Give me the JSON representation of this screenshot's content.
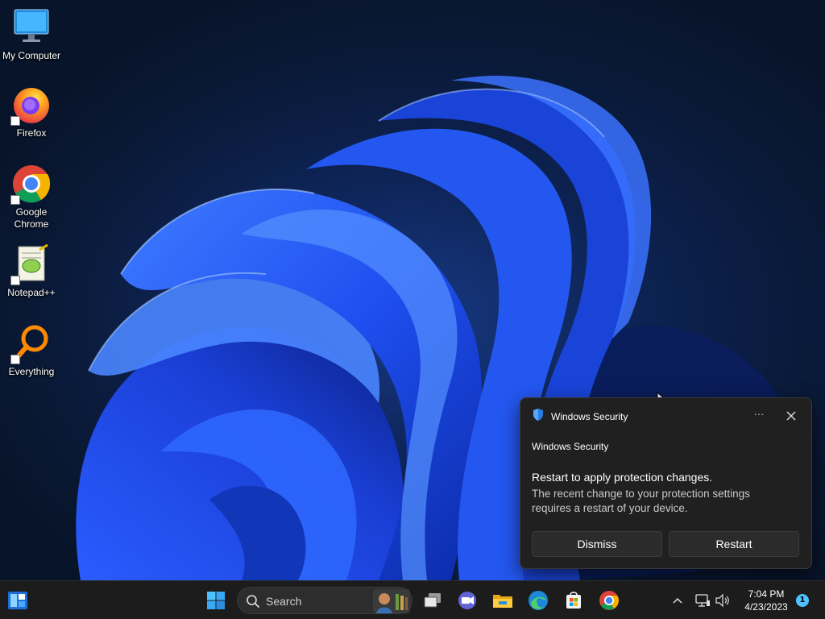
{
  "desktop": {
    "icons": [
      {
        "label": "My Computer"
      },
      {
        "label": "Firefox"
      },
      {
        "label": "Google\nChrome"
      },
      {
        "label": "Notepad++"
      },
      {
        "label": "Everything"
      }
    ]
  },
  "notification": {
    "app_name": "Windows Security",
    "more_label": "···",
    "source_title": "Windows Security",
    "message_title": "Restart to apply protection changes.",
    "message_body": "The recent change to your protection settings requires a restart of your device.",
    "dismiss_label": "Dismiss",
    "restart_label": "Restart"
  },
  "taskbar": {
    "search_placeholder": "Search",
    "pinned": [
      "widgets-icon",
      "start-icon",
      "search-icon",
      "task-view-icon",
      "teams-chat-icon",
      "file-explorer-icon",
      "edge-icon",
      "store-icon",
      "chrome-icon"
    ],
    "tray": [
      "chevron-up-icon",
      "network-icon",
      "volume-icon"
    ],
    "time": "7:04 PM",
    "date": "4/23/2023",
    "notification_count": "1"
  },
  "colors": {
    "accent": "#4cc2ff",
    "toast_bg": "#202020",
    "taskbar_bg": "#1c1c1c"
  }
}
